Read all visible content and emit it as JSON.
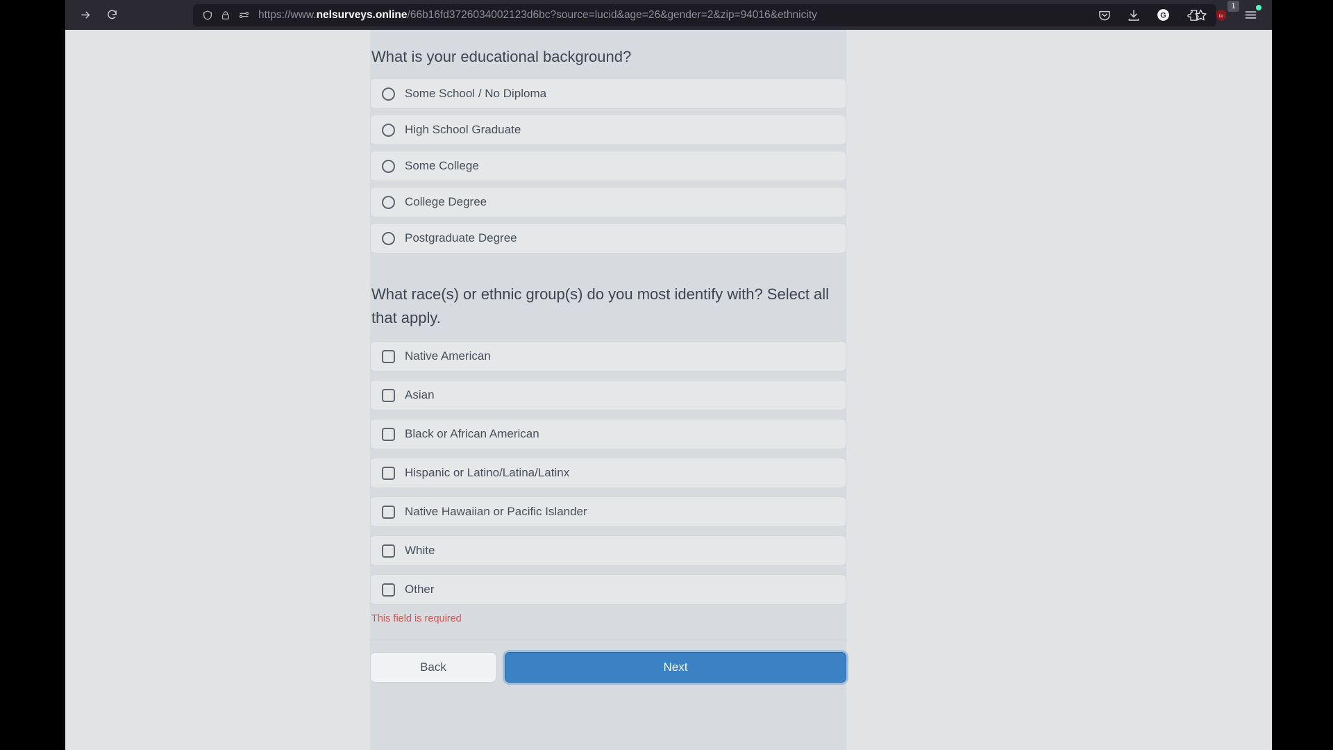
{
  "browser": {
    "nav": {
      "forward_label": "Forward",
      "reload_label": "Reload"
    },
    "url": {
      "scheme_prefix": "https://www.",
      "host": "nelsurveys.online",
      "path_query": "/66b16fd3726034002123d6bc?source=lucid&age=26&gender=2&zip=94016&ethnicity",
      "full": "https://www.nelsurveys.online/66b16fd3726034002123d6bc?source=lucid&age=26&gender=2&zip=94016&ethnicity"
    },
    "icons": {
      "shield": "shield-icon",
      "lock": "lock-icon",
      "permissions": "permissions-icon",
      "bookmark_star": "star-icon",
      "pocket": "pocket-icon",
      "downloads": "download-icon",
      "account": "G",
      "extension": "extension-icon",
      "ublock": "ublock-icon",
      "menu": "hamburger-menu-icon"
    },
    "ublock_badge": "1"
  },
  "survey": {
    "question1": {
      "text": "What is your educational background?",
      "type": "radio",
      "options": [
        "Some School / No Diploma",
        "High School Graduate",
        "Some College",
        "College Degree",
        "Postgraduate Degree"
      ]
    },
    "question2": {
      "text": "What race(s) or ethnic group(s) do you most identify with? Select all that apply.",
      "type": "checkbox",
      "options": [
        "Native American",
        "Asian",
        "Black or African American",
        "Hispanic or Latino/Latina/Latinx",
        "Native Hawaiian or Pacific Islander",
        "White",
        "Other"
      ],
      "error": "This field is required"
    },
    "footer": {
      "back_label": "Back",
      "next_label": "Next"
    }
  }
}
